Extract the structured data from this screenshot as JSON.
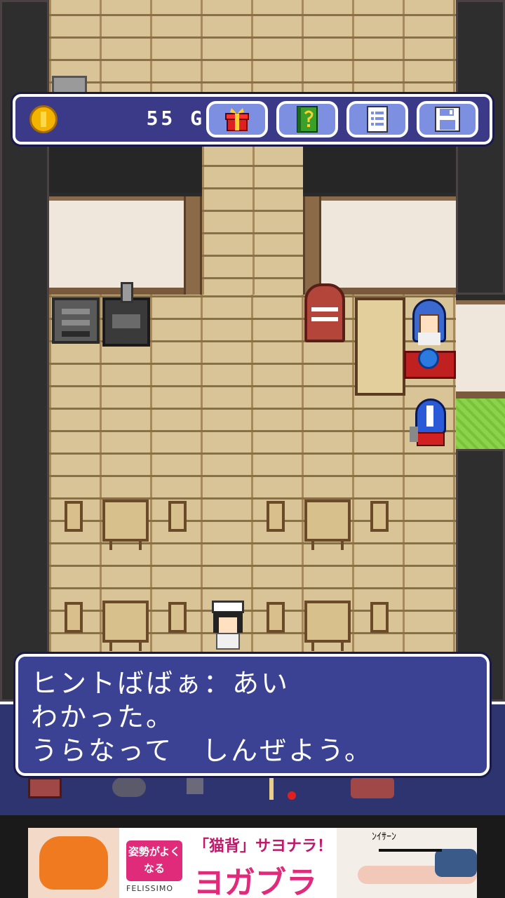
{
  "hud": {
    "gold_amount": "55",
    "gold_unit": "G",
    "buttons": [
      "gift-icon",
      "hint-book-icon",
      "menu-list-icon",
      "save-disk-icon"
    ]
  },
  "dialog": {
    "lines": [
      "ヒントばばぁ：あい",
      "わかった。",
      "うらなって　しんぜよう。"
    ]
  },
  "ad": {
    "badge": "姿勢がよくなる",
    "tagline": "「猫背」サヨナラ！",
    "product": "ヨガブラ",
    "brand": "FELISSIMO",
    "caption": "ﾝｲｻｰﾝ"
  },
  "colors": {
    "hud_bg": "#3a3a88",
    "dialog_bg": "#3b4294",
    "floor": "#d9c497",
    "coin": "#f2b400"
  }
}
